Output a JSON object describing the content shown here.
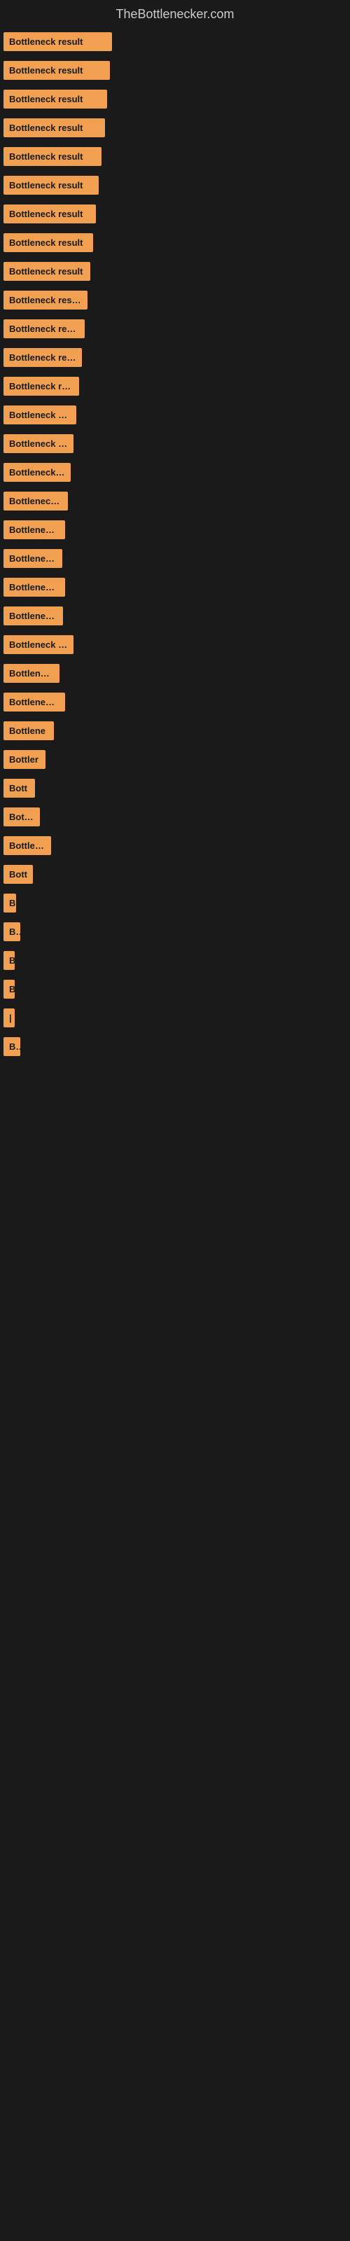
{
  "site": {
    "title": "TheBottlenecker.com"
  },
  "bars": [
    {
      "label": "Bottleneck result",
      "width": 155
    },
    {
      "label": "Bottleneck result",
      "width": 152
    },
    {
      "label": "Bottleneck result",
      "width": 148
    },
    {
      "label": "Bottleneck result",
      "width": 145
    },
    {
      "label": "Bottleneck result",
      "width": 140
    },
    {
      "label": "Bottleneck result",
      "width": 136
    },
    {
      "label": "Bottleneck result",
      "width": 132
    },
    {
      "label": "Bottleneck result",
      "width": 128
    },
    {
      "label": "Bottleneck result",
      "width": 124
    },
    {
      "label": "Bottleneck result",
      "width": 120
    },
    {
      "label": "Bottleneck result",
      "width": 116
    },
    {
      "label": "Bottleneck result",
      "width": 112
    },
    {
      "label": "Bottleneck result",
      "width": 108
    },
    {
      "label": "Bottleneck result",
      "width": 104
    },
    {
      "label": "Bottleneck result",
      "width": 100
    },
    {
      "label": "Bottleneck result",
      "width": 96
    },
    {
      "label": "Bottleneck result",
      "width": 92
    },
    {
      "label": "Bottleneck resu",
      "width": 88
    },
    {
      "label": "Bottleneck re",
      "width": 84
    },
    {
      "label": "Bottleneck resu",
      "width": 88
    },
    {
      "label": "Bottleneck res",
      "width": 85
    },
    {
      "label": "Bottleneck result",
      "width": 100
    },
    {
      "label": "Bottleneck r",
      "width": 80
    },
    {
      "label": "Bottleneck resu",
      "width": 88
    },
    {
      "label": "Bottlene",
      "width": 72
    },
    {
      "label": "Bottler",
      "width": 60
    },
    {
      "label": "Bott",
      "width": 45
    },
    {
      "label": "Bottle",
      "width": 52
    },
    {
      "label": "Bottlenec",
      "width": 68
    },
    {
      "label": "Bott",
      "width": 42
    },
    {
      "label": "B",
      "width": 18
    },
    {
      "label": "Bo",
      "width": 24
    },
    {
      "label": "B",
      "width": 16
    },
    {
      "label": "B",
      "width": 14
    },
    {
      "label": "|",
      "width": 10
    },
    {
      "label": "Bo",
      "width": 24
    }
  ]
}
